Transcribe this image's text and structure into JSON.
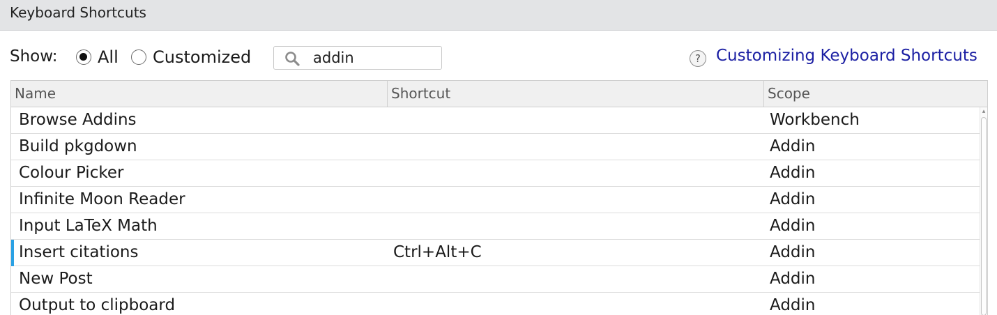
{
  "dialog": {
    "title": "Keyboard Shortcuts"
  },
  "filter": {
    "show_label": "Show:",
    "options": [
      {
        "label": "All",
        "checked": true
      },
      {
        "label": "Customized",
        "checked": false
      }
    ]
  },
  "search": {
    "value": "addin",
    "icon": "search-icon"
  },
  "help": {
    "icon_glyph": "?",
    "link_label": "Customizing Keyboard Shortcuts"
  },
  "table": {
    "columns": [
      "Name",
      "Shortcut",
      "Scope"
    ],
    "rows": [
      {
        "name": "Browse Addins",
        "shortcut": "",
        "scope": "Workbench"
      },
      {
        "name": "Build pkgdown",
        "shortcut": "",
        "scope": "Addin"
      },
      {
        "name": "Colour Picker",
        "shortcut": "",
        "scope": "Addin"
      },
      {
        "name": "Infinite Moon Reader",
        "shortcut": "",
        "scope": "Addin"
      },
      {
        "name": "Input LaTeX Math",
        "shortcut": "",
        "scope": "Addin"
      },
      {
        "name": "Insert citations",
        "shortcut": "Ctrl+Alt+C",
        "scope": "Addin",
        "selected": true
      },
      {
        "name": "New Post",
        "shortcut": "",
        "scope": "Addin"
      },
      {
        "name": "Output to clipboard",
        "shortcut": "",
        "scope": "Addin"
      }
    ]
  },
  "colors": {
    "link": "#1b1fa3",
    "selection_marker": "#2aa1e4",
    "titlebar_bg": "#e3e4e6"
  }
}
